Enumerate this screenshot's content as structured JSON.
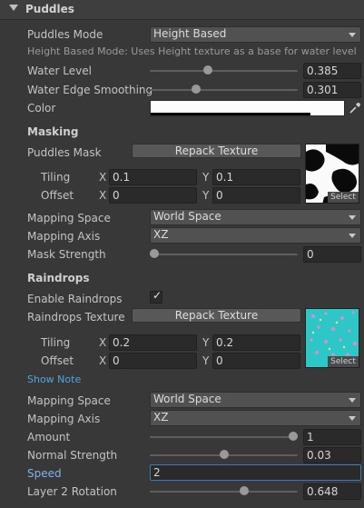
{
  "header": {
    "title": "Puddles"
  },
  "puddles_mode": {
    "label": "Puddles Mode",
    "value": "Height Based"
  },
  "mode_hint": "Height Based Mode: Uses Height texture as a base for water level",
  "water_level": {
    "label": "Water Level",
    "value": "0.385",
    "fraction": 0.385
  },
  "water_edge": {
    "label": "Water Edge Smoothing",
    "value": "0.301",
    "fraction": 0.301
  },
  "color": {
    "label": "Color",
    "value_color": "#ffffff"
  },
  "masking": {
    "title": "Masking",
    "puddles_mask_label": "Puddles Mask",
    "repack_label": "Repack Texture",
    "select_label": "Select",
    "tiling": {
      "label": "Tiling",
      "x_label": "X",
      "x": "0.1",
      "y_label": "Y",
      "y": "0.1"
    },
    "offset": {
      "label": "Offset",
      "x_label": "X",
      "x": "0",
      "y_label": "Y",
      "y": "0"
    },
    "mapping_space": {
      "label": "Mapping Space",
      "value": "World Space"
    },
    "mapping_axis": {
      "label": "Mapping Axis",
      "value": "XZ"
    },
    "mask_strength": {
      "label": "Mask Strength",
      "value": "0",
      "fraction": 0
    }
  },
  "raindrops": {
    "title": "Raindrops",
    "enable_label": "Enable Raindrops",
    "enable_checked": true,
    "checkmark": "✓",
    "texture_label": "Raindrops Texture",
    "repack_label": "Repack Texture",
    "select_label": "Select",
    "tiling": {
      "label": "Tiling",
      "x_label": "X",
      "x": "0.2",
      "y_label": "Y",
      "y": "0.2"
    },
    "offset": {
      "label": "Offset",
      "x_label": "X",
      "x": "0",
      "y_label": "Y",
      "y": "0"
    },
    "show_note": "Show Note",
    "mapping_space": {
      "label": "Mapping Space",
      "value": "World Space"
    },
    "mapping_axis": {
      "label": "Mapping Axis",
      "value": "XZ"
    },
    "amount": {
      "label": "Amount",
      "value": "1",
      "fraction": 1
    },
    "normal_strength": {
      "label": "Normal Strength",
      "value": "0.03",
      "fraction": 0.5
    },
    "speed": {
      "label": "Speed",
      "value": "2"
    },
    "layer2_rotation": {
      "label": "Layer 2 Rotation",
      "value": "0.648",
      "fraction": 0.648
    }
  },
  "colors": {
    "panel": "#383838",
    "link": "#4ea6e2",
    "focus": "#3a79bb",
    "raindrop_tex": "#2ec7c7"
  }
}
